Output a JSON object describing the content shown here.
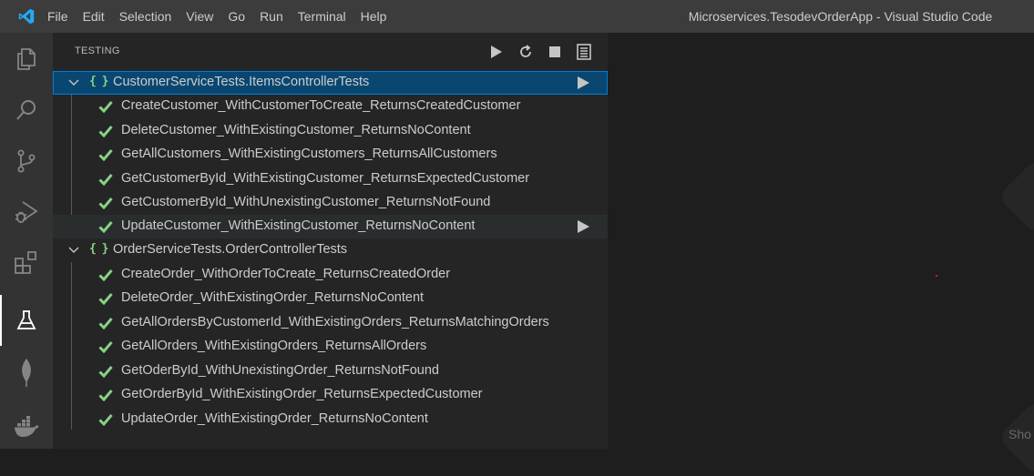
{
  "menu": [
    "File",
    "Edit",
    "Selection",
    "View",
    "Go",
    "Run",
    "Terminal",
    "Help"
  ],
  "window_title": "Microservices.TesodevOrderApp - Visual Studio Code",
  "activity_bar": [
    {
      "name": "explorer-icon"
    },
    {
      "name": "search-icon"
    },
    {
      "name": "source-control-icon"
    },
    {
      "name": "run-debug-icon"
    },
    {
      "name": "extensions-icon"
    },
    {
      "name": "testing-icon",
      "active": true
    },
    {
      "name": "mongodb-leaf-icon"
    },
    {
      "name": "docker-whale-icon"
    }
  ],
  "sidebar": {
    "title": "TESTING",
    "actions": [
      "run-all-tests-icon",
      "refresh-tests-icon",
      "stop-icon",
      "show-output-icon"
    ]
  },
  "suites": [
    {
      "label": "CustomerServiceTests.ItemsControllerTests",
      "tests": [
        "CreateCustomer_WithCustomerToCreate_ReturnsCreatedCustomer",
        "DeleteCustomer_WithExistingCustomer_ReturnsNoContent",
        "GetAllCustomers_WithExistingCustomers_ReturnsAllCustomers",
        "GetCustomerById_WithExistingCustomer_ReturnsExpectedCustomer",
        "GetCustomerById_WithUnexistingCustomer_ReturnsNotFound",
        "UpdateCustomer_WithExistingCustomer_ReturnsNoContent"
      ]
    },
    {
      "label": "OrderServiceTests.OrderControllerTests",
      "tests": [
        "CreateOrder_WithOrderToCreate_ReturnsCreatedOrder",
        "DeleteOrder_WithExistingOrder_ReturnsNoContent",
        "GetAllOrdersByCustomerId_WithExistingOrders_ReturnsMatchingOrders",
        "GetAllOrders_WithExistingOrders_ReturnsAllOrders",
        "GetOderById_WithUnexistingOrder_ReturnsNotFound",
        "GetOrderById_WithExistingOrder_ReturnsExpectedCustomer",
        "UpdateOrder_WithExistingOrder_ReturnsNoContent"
      ]
    }
  ],
  "editor_corner_text": "Sho",
  "colors": {
    "pass": "#89d185",
    "selection": "#094771",
    "focus_border": "#007fd4",
    "vscode_blue": "#23a9f2"
  }
}
